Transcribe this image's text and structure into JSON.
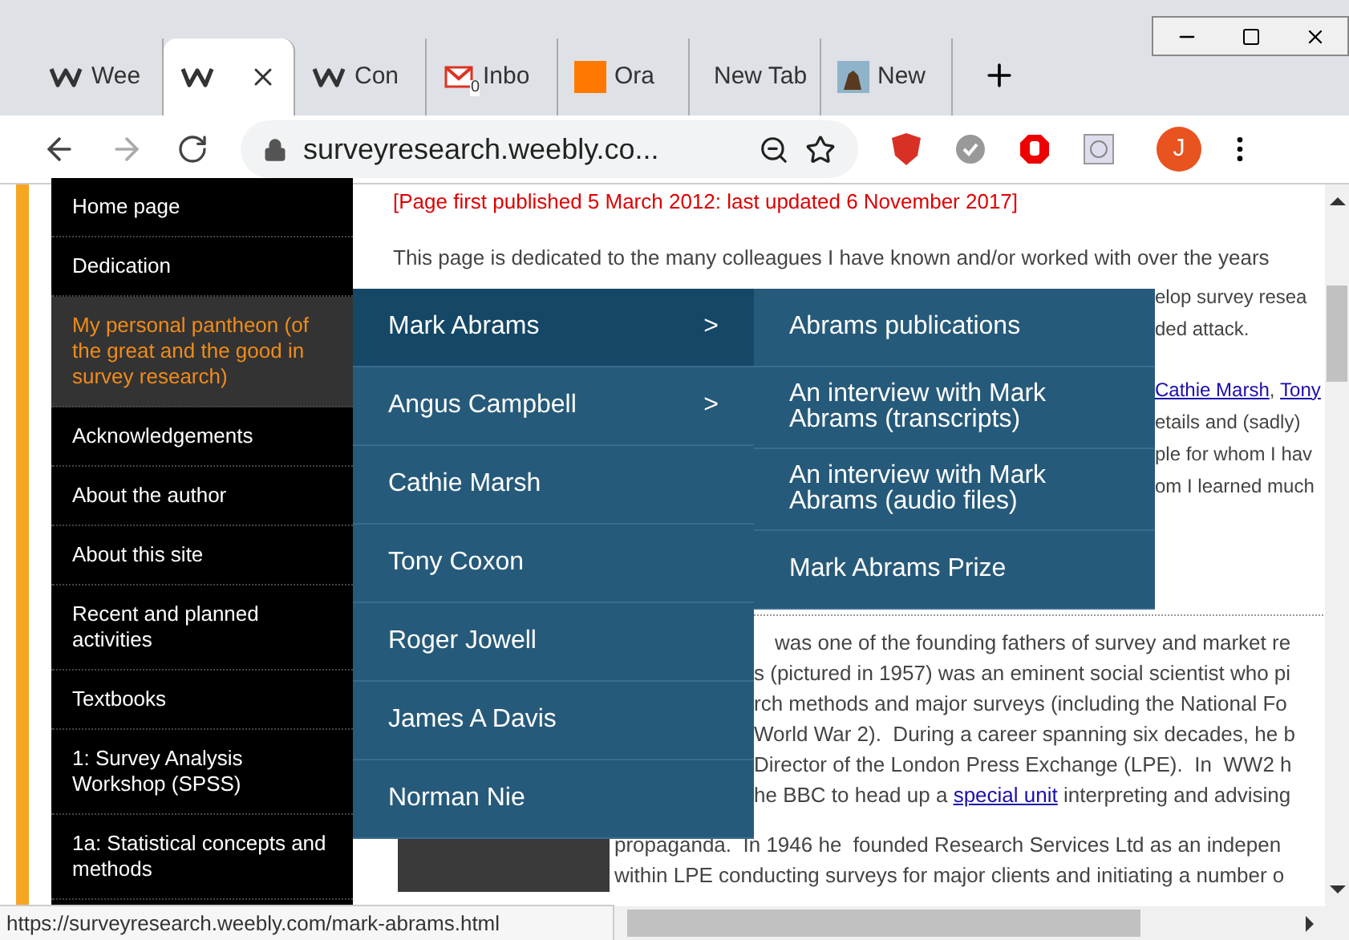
{
  "tabs": [
    {
      "kind": "weebly",
      "label": "Wee",
      "selected": false
    },
    {
      "kind": "weebly",
      "selected": true
    },
    {
      "kind": "weebly",
      "label": "Con",
      "selected": false
    },
    {
      "kind": "mail",
      "label": "Inbo",
      "badge": "0",
      "selected": false
    },
    {
      "kind": "orange",
      "label": "Ora",
      "selected": false
    },
    {
      "kind": "plain",
      "label": "New Tab",
      "selected": false
    },
    {
      "kind": "dog",
      "label": "New",
      "selected": false
    }
  ],
  "address_bar": {
    "url": "surveyresearch.weebly.co..."
  },
  "profile": {
    "initial": "J"
  },
  "sidebar": {
    "items": [
      {
        "label": "Home page",
        "selected": false
      },
      {
        "label": "Dedication",
        "selected": false
      },
      {
        "label": "My personal pantheon (of the great and the good in survey research)",
        "selected": true
      },
      {
        "label": "Acknowledgements",
        "selected": false
      },
      {
        "label": "About the author",
        "selected": false
      },
      {
        "label": "About this site",
        "selected": false
      },
      {
        "label": "Recent and planned activities",
        "selected": false
      },
      {
        "label": "Textbooks",
        "selected": false
      },
      {
        "label": "1: Survey Analysis Workshop (SPSS)",
        "selected": false
      },
      {
        "label": "1a: Statistical concepts and methods",
        "selected": false
      }
    ]
  },
  "menu": {
    "items": [
      {
        "label": "Mark Abrams",
        "arrow": ">",
        "selected": true
      },
      {
        "label": "Angus Campbell",
        "arrow": ">",
        "selected": false
      },
      {
        "label": "Cathie Marsh",
        "selected": false
      },
      {
        "label": "Tony Coxon",
        "selected": false
      },
      {
        "label": "Roger Jowell",
        "selected": false
      },
      {
        "label": "James A Davis",
        "selected": false
      },
      {
        "label": "Norman Nie",
        "selected": false
      }
    ]
  },
  "submenu": {
    "items": [
      {
        "label": "Abrams publications"
      },
      {
        "label": "An interview with Mark Abrams (transcripts)"
      },
      {
        "label": "An interview with Mark Abrams (audio files)"
      },
      {
        "label": "Mark Abrams Prize"
      }
    ]
  },
  "content": {
    "date_line": "[Page first published 5 March 2012: last updated 6 November 2017]",
    "intro_line": "This page is dedicated to the many colleagues I have known and/or worked with over the years",
    "lines_beside_submenu": [
      [
        {
          "kind": "text",
          "text": "elop survey resea"
        }
      ],
      [
        {
          "kind": "text",
          "text": "ded attack."
        }
      ],
      [
        {
          "kind": "link",
          "text": "Cathie Marsh"
        },
        {
          "kind": "text",
          "text": ", "
        },
        {
          "kind": "link",
          "text": "Tony"
        }
      ],
      [
        {
          "kind": "text",
          "text": "etails and (sadly)"
        }
      ],
      [
        {
          "kind": "text",
          "text": "ple for whom I hav"
        }
      ],
      [
        {
          "kind": "text",
          "text": "om I learned much"
        }
      ]
    ],
    "lines_beside_menu": [
      [
        {
          "kind": "text",
          "text": "was one of the founding fathers of survey and market re"
        }
      ],
      [
        {
          "kind": "text",
          "text": "s (pictured in 1957) was an eminent social scientist who pi"
        }
      ],
      [
        {
          "kind": "text",
          "text": "rch methods and major surveys (including the National Fo"
        }
      ],
      [
        {
          "kind": "text",
          "text": "World War 2).  During a career spanning six decades, he b"
        }
      ],
      [
        {
          "kind": "text",
          "text": "Director of the London Press Exchange (LPE).  In  WW2 h"
        }
      ],
      [
        {
          "kind": "text",
          "text": "he BBC to head up a "
        },
        {
          "kind": "link",
          "text": "special unit"
        },
        {
          "kind": "text",
          "text": " interpreting and advising"
        }
      ]
    ],
    "lines_below_menu": [
      [
        {
          "kind": "text",
          "text": "propaganda.  In 1946 he  founded Research Services Ltd as an indepen"
        }
      ],
      [
        {
          "kind": "text",
          "text": "within LPE conducting surveys for major clients and initiating a number o"
        }
      ]
    ]
  },
  "status_bar": {
    "url": "https://surveyresearch.weebly.com/mark-abrams.html"
  }
}
